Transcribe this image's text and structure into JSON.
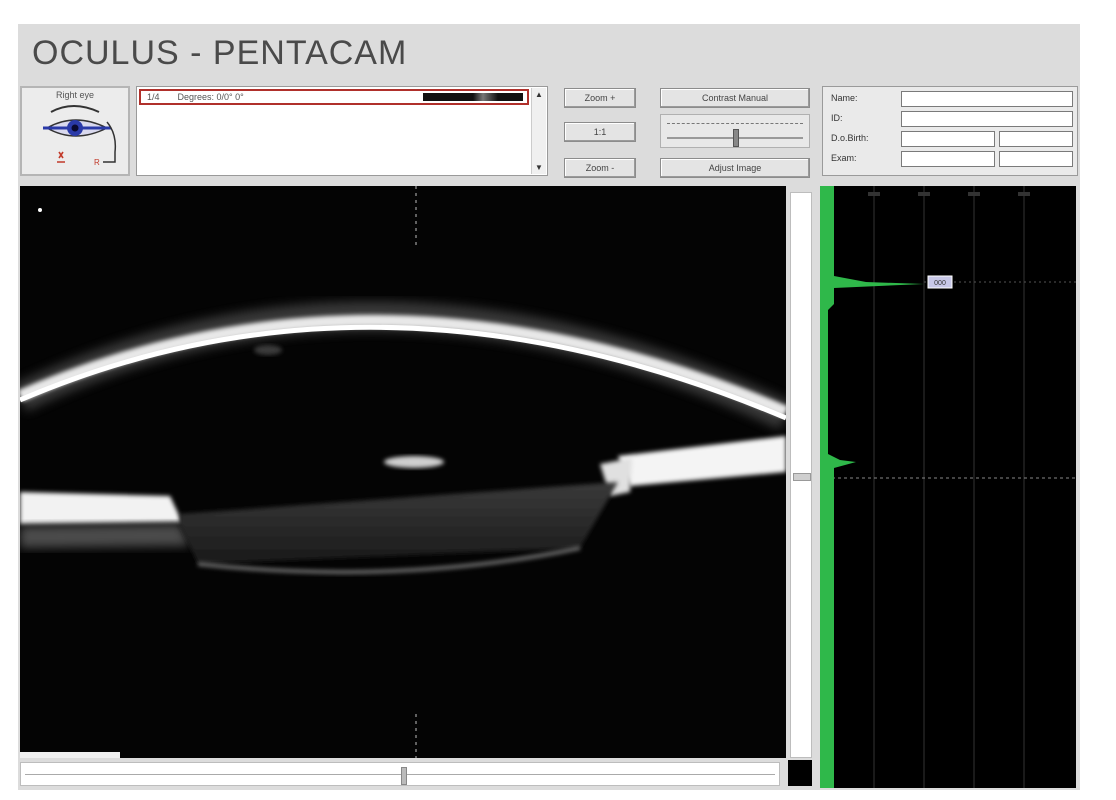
{
  "app": {
    "title": "OCULUS  -  PENTACAM"
  },
  "eye_panel": {
    "label": "Right eye",
    "marker": "R"
  },
  "scan_list": {
    "row_index": "1/4",
    "row_label": "Degrees: 0/0° 0°"
  },
  "toolbar": {
    "zoom_in_label": "Zoom +",
    "one_to_one_label": "1:1",
    "zoom_out_label": "Zoom -",
    "contrast_label": "Contrast Manual",
    "adjust_label": "Adjust Image"
  },
  "patient_info": {
    "name_label": "Name:",
    "id_label": "ID:",
    "dob_label": "D.o.Birth:",
    "exam_label": "Exam:",
    "name_value": "",
    "id_value": "",
    "dob_value": "",
    "exam_value": ""
  },
  "densitometry": {
    "peak_value": "000",
    "colors": {
      "profile": "#2fb84a",
      "background": "#000000",
      "grid": "#444444"
    }
  },
  "icons": [
    "eye-icon",
    "scroll-up-icon",
    "scroll-down-icon"
  ]
}
